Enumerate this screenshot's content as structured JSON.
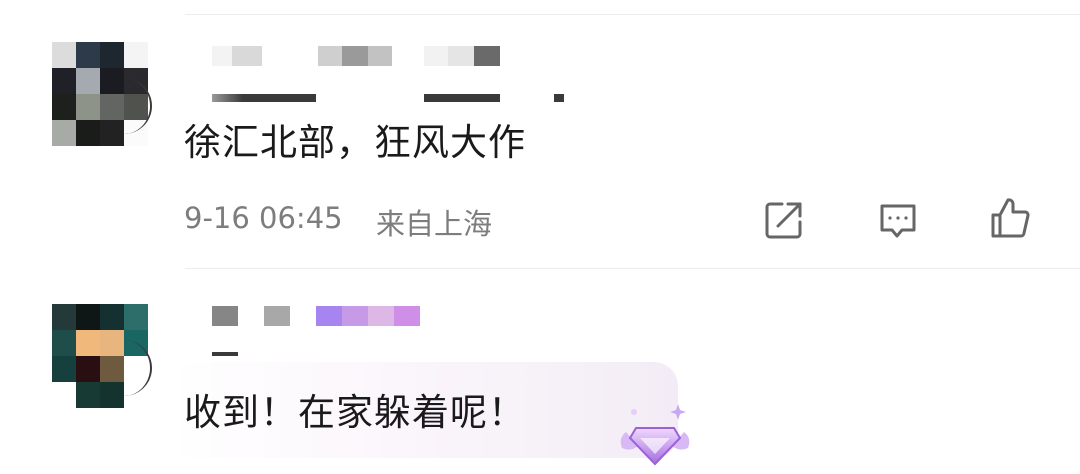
{
  "comments": [
    {
      "text": "徐汇北部，狂风大作",
      "date": "9-16 06:45",
      "location": "来自上海",
      "actions": [
        {
          "name": "share-icon"
        },
        {
          "name": "comment-icon"
        },
        {
          "name": "like-icon"
        }
      ]
    },
    {
      "text": "收到！在家躲着呢！",
      "badge": "gem-badge-icon"
    }
  ],
  "colors": {
    "text": "#1a1a1a",
    "meta": "#7d7d7d",
    "icon": "#666666",
    "divider": "#ececec",
    "badge": "#b98ae6"
  }
}
